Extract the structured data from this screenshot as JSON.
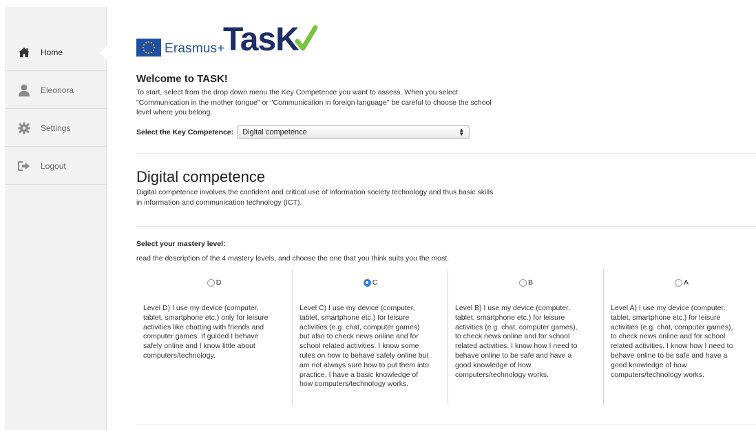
{
  "sidebar": {
    "items": [
      {
        "label": "Home",
        "icon": "home-icon",
        "active": true
      },
      {
        "label": "Eleonora",
        "icon": "user-icon",
        "active": false
      },
      {
        "label": "Settings",
        "icon": "gear-icon",
        "active": false
      },
      {
        "label": "Logout",
        "icon": "logout-icon",
        "active": false
      }
    ]
  },
  "logo": {
    "erasmus": "Erasmus+",
    "task": "TasK"
  },
  "welcome": {
    "title": "Welcome to TASK!",
    "text": "To start, select from the drop down menu the Key Competence you want to assess. When you select \"Communication in the mother tongue\" or \"Communication in foreign language\" be careful to choose the school level where you belong."
  },
  "select": {
    "label": "Select the Key Competence:",
    "value": "Digital competence"
  },
  "competence": {
    "title": "Digital competence",
    "description": "Digital competence involves the confident and critical use of information society technology and thus basic skills in information and communication technology (ICT)."
  },
  "mastery": {
    "title": "Select your mastery level:",
    "subtitle": "read the description of the 4 mastery levels, and choose the one that you think suits you the most.",
    "levels": [
      {
        "label": "D",
        "checked": false,
        "text": "Level D) I use my device (computer, tablet, smartphone etc.) only for leisure activities like chatting with friends and computer games. If guided I behave safely online and I know little about computers/technology."
      },
      {
        "label": "C",
        "checked": true,
        "text": "Level C) I use my device (computer, tablet, smartphone etc.) for leisure activities (e.g. chat, computer games) but also to check news online and for school related activities. I know some rules on how to behave safely online but am not always sure how to put them into practice. I have a basic knowledge of how computers/technology works."
      },
      {
        "label": "B",
        "checked": false,
        "text": "Level B) I use my device (computer, tablet, smartphone etc.) for leisure activities (e.g. chat, computer games), to check news online and for school related activities. I know how I need to behave online to be safe and have a good knowledge of how computers/technology works."
      },
      {
        "label": "A",
        "checked": false,
        "text": "Level A) I use my device (computer, tablet, smartphone etc.) for leisure activities (e.g. chat, computer games), to check news online and for school related activities. I know how I need to behave online to be safe and have a good knowledge of how computers/technology works."
      }
    ]
  },
  "colors": {
    "accent": "#2f7ce8",
    "brand_navy": "#1b2f66",
    "brand_green": "#7cc242",
    "eu_blue": "#1f4fa3"
  }
}
